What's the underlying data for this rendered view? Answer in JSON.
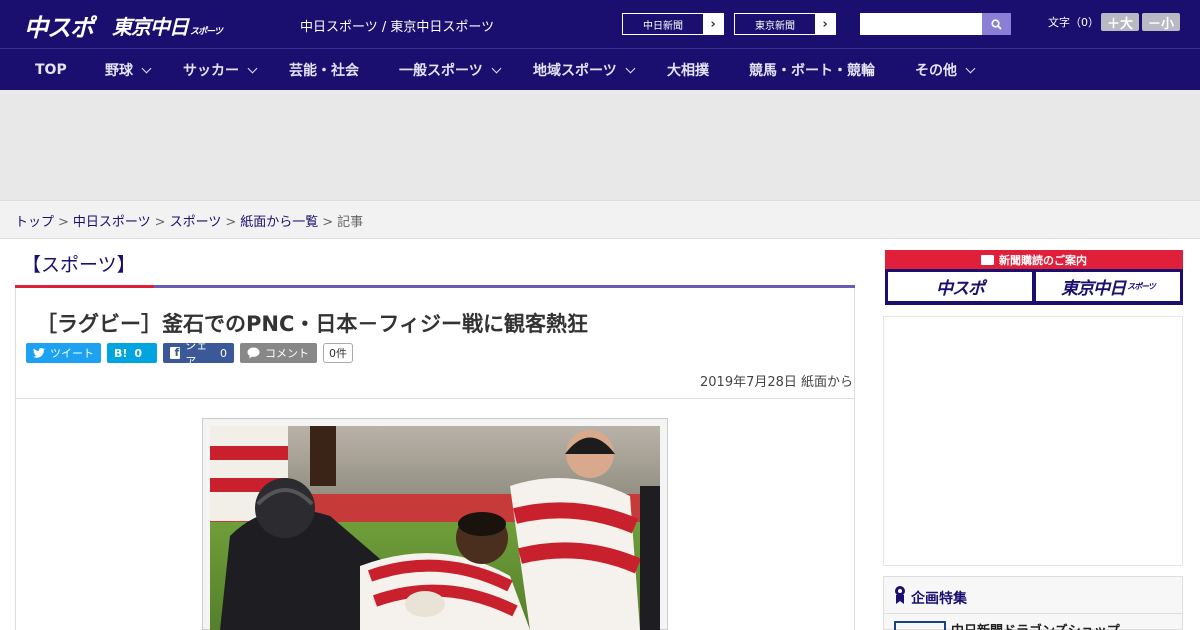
{
  "header": {
    "logo_primary": "中スポ",
    "logo_secondary": "東京中日",
    "logo_secondary_sub": "スポーツ",
    "site_links": "中日スポーツ / 東京中日スポーツ",
    "external_links": [
      {
        "label": "中日新聞"
      },
      {
        "label": "東京新聞"
      }
    ],
    "search": {
      "placeholder": "",
      "value": ""
    },
    "font_size": {
      "label": "文字（0）",
      "bigger": "＋大",
      "smaller": "－小"
    }
  },
  "nav": {
    "items": [
      {
        "label": "TOP",
        "dropdown": false
      },
      {
        "label": "野球",
        "dropdown": true
      },
      {
        "label": "サッカー",
        "dropdown": true
      },
      {
        "label": "芸能・社会",
        "dropdown": false
      },
      {
        "label": "一般スポーツ",
        "dropdown": true
      },
      {
        "label": "地域スポーツ",
        "dropdown": true
      },
      {
        "label": "大相撲",
        "dropdown": false
      },
      {
        "label": "競馬・ボート・競輪",
        "dropdown": false
      },
      {
        "label": "その他",
        "dropdown": true
      }
    ]
  },
  "breadcrumb": {
    "items": [
      "トップ",
      "中日スポーツ",
      "スポーツ",
      "紙面から一覧"
    ],
    "current": "記事",
    "separator": ">"
  },
  "article": {
    "section": "【スポーツ】",
    "headline": "［ラグビー］釜石でのPNC・日本－フィジー戦に観客熱狂",
    "share": {
      "tweet_label": "ツイート",
      "hatena_label": "B!",
      "hatena_count": "0",
      "facebook_label": "シェア",
      "facebook_count": "0",
      "comment_label": "コメント",
      "comment_count": "0件"
    },
    "date": "2019年7月28日 紙面から"
  },
  "sidebar": {
    "subscribe_title": "新聞購読のご案内",
    "subscribe_buttons": [
      {
        "label": "中スポ"
      },
      {
        "label": "東京中日",
        "sub": "スポーツ"
      }
    ],
    "feature_title": "企画特集",
    "feature_item": "中日新聞ドラゴンズショップ"
  },
  "colors": {
    "brand_navy": "#1a0f6f",
    "accent_red": "#e0203a",
    "accent_purple": "#6a5bb4"
  }
}
